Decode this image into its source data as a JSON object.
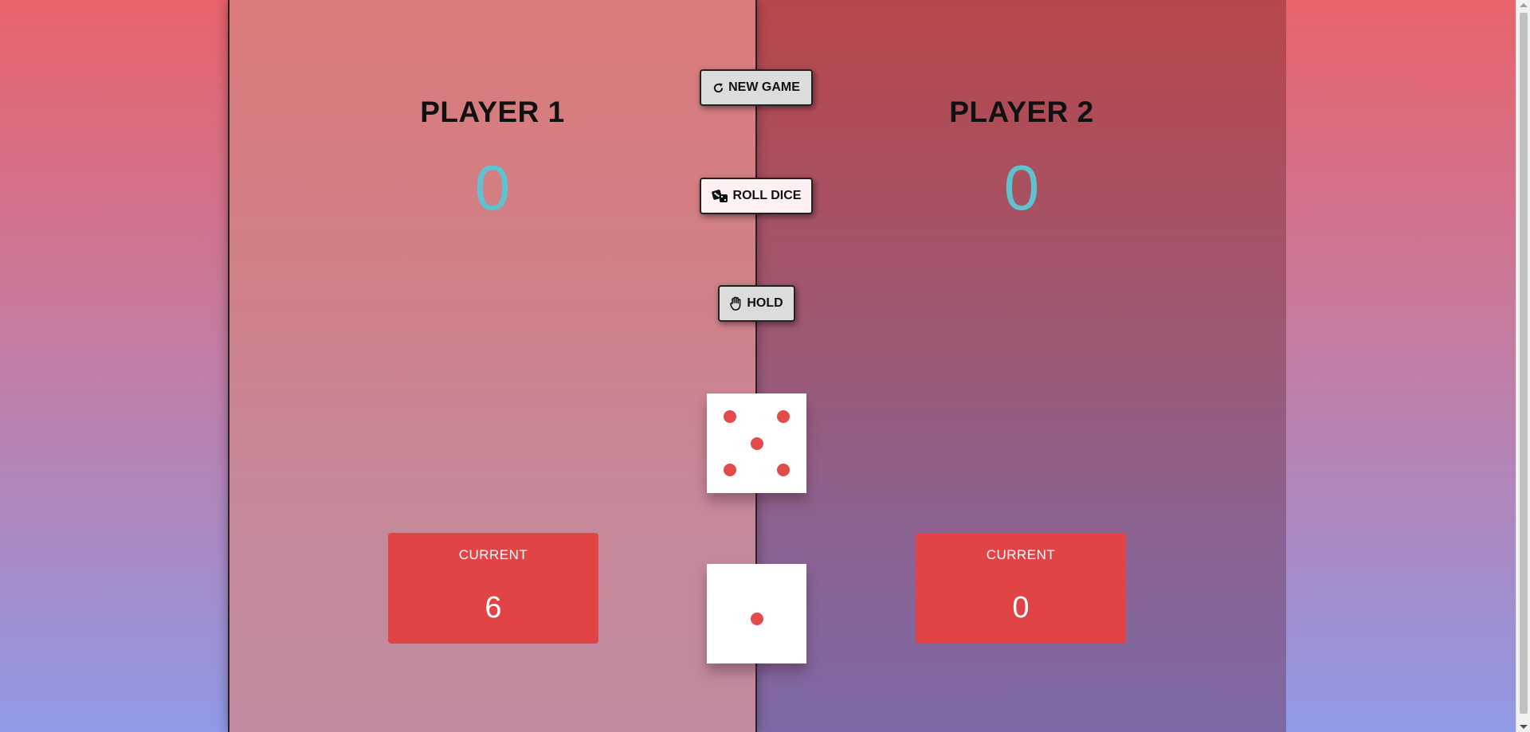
{
  "controls": {
    "new_game_label": "NEW GAME",
    "roll_dice_label": "ROLL DICE",
    "hold_label": "HOLD"
  },
  "players": [
    {
      "name": "PLAYER 1",
      "score": "0",
      "current_label": "CURRENT",
      "current_value": "6",
      "active": true
    },
    {
      "name": "PLAYER 2",
      "score": "0",
      "current_label": "CURRENT",
      "current_value": "0",
      "active": false
    }
  ],
  "dice": [
    {
      "value": 5,
      "pip_color": "#e34b4b"
    },
    {
      "value": 1,
      "pip_color": "#e34b4b"
    }
  ],
  "colors": {
    "score": "#5ec3cf",
    "current_box": "#e14444"
  },
  "icons": {
    "new_game": "rotate-right-icon",
    "roll_dice": "dice-icon",
    "hold": "hand-icon"
  }
}
